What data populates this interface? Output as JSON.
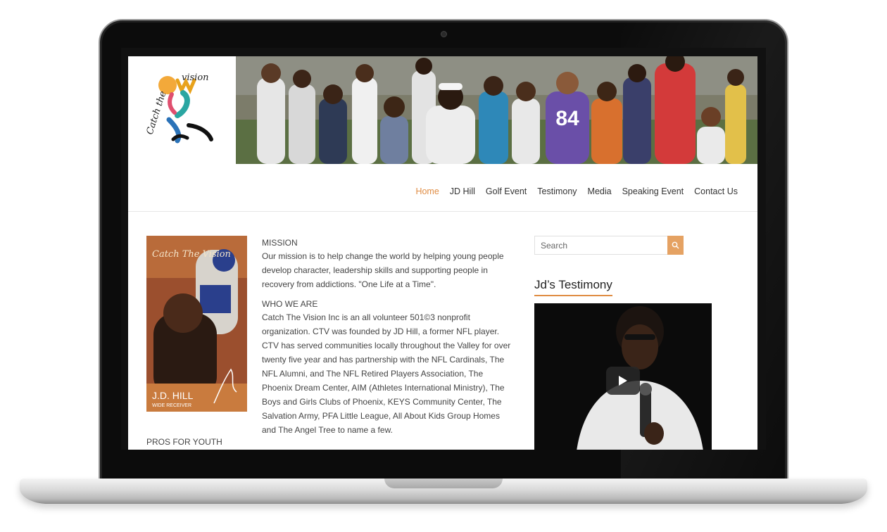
{
  "site": {
    "logo_text": "Catch the Vision",
    "nav": [
      {
        "label": "Home",
        "active": true
      },
      {
        "label": "JD Hill",
        "active": false
      },
      {
        "label": "Golf Event",
        "active": false
      },
      {
        "label": "Testimony",
        "active": false
      },
      {
        "label": "Media",
        "active": false
      },
      {
        "label": "Speaking Event",
        "active": false
      },
      {
        "label": "Contact Us",
        "active": false
      }
    ],
    "accent_color": "#e08d44"
  },
  "banner": {
    "jersey_number": "84"
  },
  "book": {
    "title": "Catch The Vision",
    "name": "J.D. HILL",
    "subtitle": "WIDE RECEIVER"
  },
  "content": {
    "mission_heading": "MISSION",
    "mission_text": "Our mission is to help change the world by helping young people develop character, leadership skills and supporting people in recovery from addictions.  \"One Life at a Time\".",
    "who_heading": "WHO WE ARE",
    "who_text": "Catch The Vision Inc is an all volunteer 501©3 nonprofit organization. CTV was founded by JD Hill, a former NFL player. CTV has served communities locally throughout the Valley for over twenty five year and has partnership with the NFL Cardinals, The NFL Alumni, and The NFL Retired Players Association, The Phoenix Dream Center, AIM (Athletes International Ministry), The Boys and Girls Clubs of Phoenix, KEYS Community Center, The Salvation Army, PFA Little League, All About Kids Group Homes and The Angel Tree to name a few.",
    "pros_heading": "PROS FOR YOUTH"
  },
  "sidebar": {
    "search_placeholder": "Search",
    "widget_title": "Jd’s Testimony",
    "search_icon": "search-icon",
    "play_icon": "play-icon"
  }
}
